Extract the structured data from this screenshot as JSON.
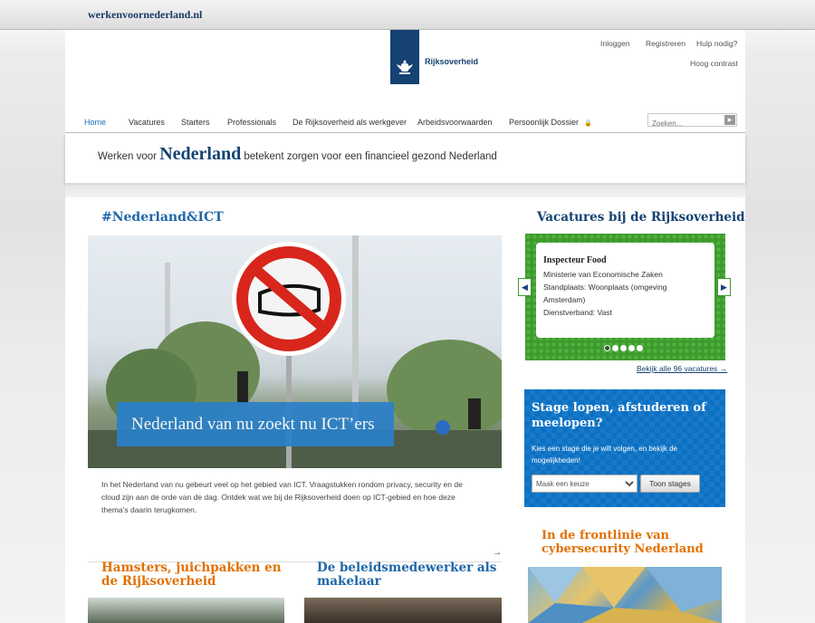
{
  "browser": {
    "url": "werkenvoornederland.nl"
  },
  "header": {
    "logo_text": "Rijksoverheid",
    "util_links": [
      "Inloggen",
      "Registreren",
      "Hulp nodig?"
    ],
    "high_contrast": "Hoog contrast"
  },
  "nav": {
    "items": [
      "Home",
      "Vacatures",
      "Starters",
      "Professionals",
      "De Rijksoverheid als werkgever",
      "Arbeidsvoorwaarden",
      "Persoonlijk Dossier"
    ],
    "active": "Home",
    "search_placeholder": "Zoeken..."
  },
  "tagline": {
    "prefix": "Werken voor",
    "big": "Nederland",
    "suffix": "betekent zorgen voor een financieel gezond Nederland"
  },
  "feature": {
    "heading": "#Nederland&ICT",
    "banner": "Nederland van nu zoekt nu ICT’ers",
    "intro": "In het Nederland van nu gebeurt veel op het gebied van ICT. Vraagstukken rondom privacy, security en de cloud zijn aan de orde van de dag. Ontdek wat we bij de Rijksoverheid doen op ICT-gebied en hoe deze thema’s daarin terugkomen."
  },
  "articles": [
    {
      "title": "Hamsters, juichpakken en de Rijksoverheid"
    },
    {
      "title": "De beleidsmedewerker als makelaar"
    }
  ],
  "vacatures": {
    "heading": "Vacatures bij de Rijksoverheid",
    "card": {
      "title": "Inspecteur Food",
      "org": "Ministerie van Economische Zaken",
      "location": "Standplaats: Woonplaats (omgeving Amsterdam)",
      "employment": "Dienstverband: Vast"
    },
    "slides": 5,
    "active_slide": 1,
    "all_link": "Bekijk alle 96 vacatures"
  },
  "stage": {
    "heading": "Stage lopen, afstuderen of meelopen?",
    "description": "Kies een stage die je wilt volgen, en bekijk de mogelijkheden!",
    "select_value": "Maak een keuze",
    "button": "Toon stages"
  },
  "cyber": {
    "heading": "In de frontlinie van cybersecurity Nederland"
  },
  "colors": {
    "brand_blue": "#154273",
    "heading_blue": "#1f67a8",
    "orange": "#e17000",
    "green": "#3d9b2e",
    "stage_blue": "#0b71c4"
  }
}
